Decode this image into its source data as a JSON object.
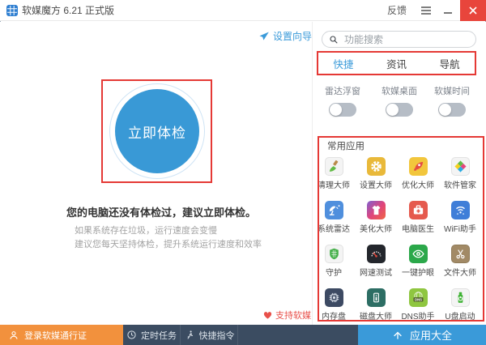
{
  "window": {
    "title": "软媒魔方 6.21 正式版",
    "feedback_label": "反馈"
  },
  "left_panel": {
    "setup_wizard_label": "设置向导",
    "check_button_label": "立即体检",
    "headline": "您的电脑还没有体检过，建议立即体检。",
    "tip1": "如果系统存在垃圾，运行速度会变慢",
    "tip2": "建议您每天坚持体检，提升系统运行速度和效率",
    "support_label": "支持软媒"
  },
  "right_panel": {
    "search_placeholder": "功能搜索",
    "tabs": [
      {
        "label": "快捷",
        "active": true
      },
      {
        "label": "资讯",
        "active": false
      },
      {
        "label": "导航",
        "active": false
      }
    ],
    "toggles": [
      {
        "label": "雷达浮窗",
        "state": "off"
      },
      {
        "label": "软媒桌面",
        "state": "off"
      },
      {
        "label": "软媒时间",
        "state": "off"
      }
    ],
    "apps_header": "常用应用",
    "apps": [
      {
        "name": "清理大师"
      },
      {
        "name": "设置大师"
      },
      {
        "name": "优化大师"
      },
      {
        "name": "软件管家"
      },
      {
        "name": "系统雷达"
      },
      {
        "name": "美化大师"
      },
      {
        "name": "电脑医生"
      },
      {
        "name": "WiFi助手"
      },
      {
        "name": "守护"
      },
      {
        "name": "网速测试"
      },
      {
        "name": "一键护眼"
      },
      {
        "name": "文件大师"
      },
      {
        "name": "内存盘"
      },
      {
        "name": "磁盘大师"
      },
      {
        "name": "DNS助手",
        "icon_text": "DNS"
      },
      {
        "name": "U盘启动"
      }
    ]
  },
  "bottom_bar": {
    "login_label": "登录软媒通行证",
    "scheduled_label": "定时任务",
    "shortcut_label": "快捷指令",
    "all_apps_label": "应用大全"
  },
  "colors": {
    "accent_blue": "#3a9ad9",
    "annotation_red": "#e53935",
    "close_red": "#e8453c",
    "login_orange": "#f2913d",
    "bar_dark": "#3b4c61"
  }
}
